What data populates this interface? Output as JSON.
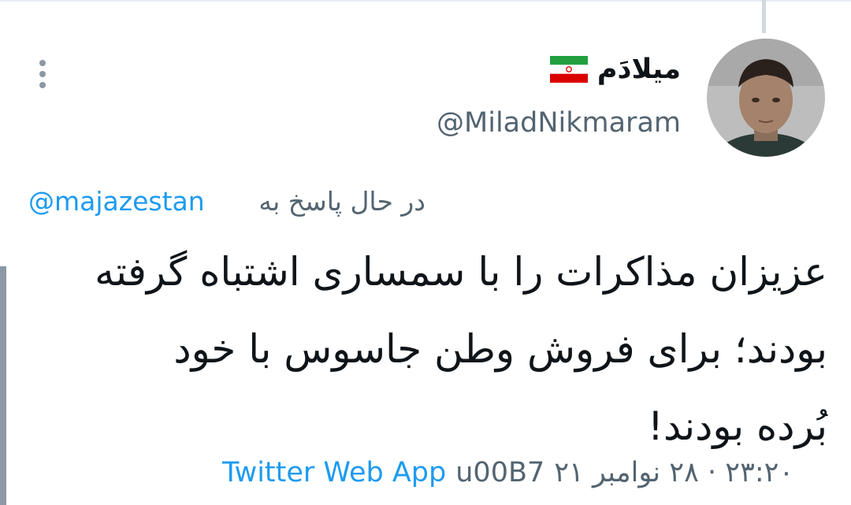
{
  "user": {
    "display_name": "میلادَم",
    "flag_icon": "iran-flag-icon",
    "handle": "@MiladNikmaram"
  },
  "reply": {
    "prefix": "در حال پاسخ به",
    "to_handle": "@majazestan"
  },
  "tweet": {
    "lines": [
      "عزیزان مذاکرات را با سمساری اشتباه گرفته",
      "بودند؛ برای فروش وطن جاسوس با خود",
      "بُرده بودند!"
    ]
  },
  "meta": {
    "source": "Twitter Web App",
    "separator": "u00B7",
    "timestamp": "۲۳:۲۰ · ۲۸ نوامبر ۲۱"
  },
  "colors": {
    "link": "#1d9bf0",
    "secondary_text": "#536471",
    "primary_text": "#0f1419"
  },
  "icons": {
    "more": "more-vertical-icon"
  }
}
